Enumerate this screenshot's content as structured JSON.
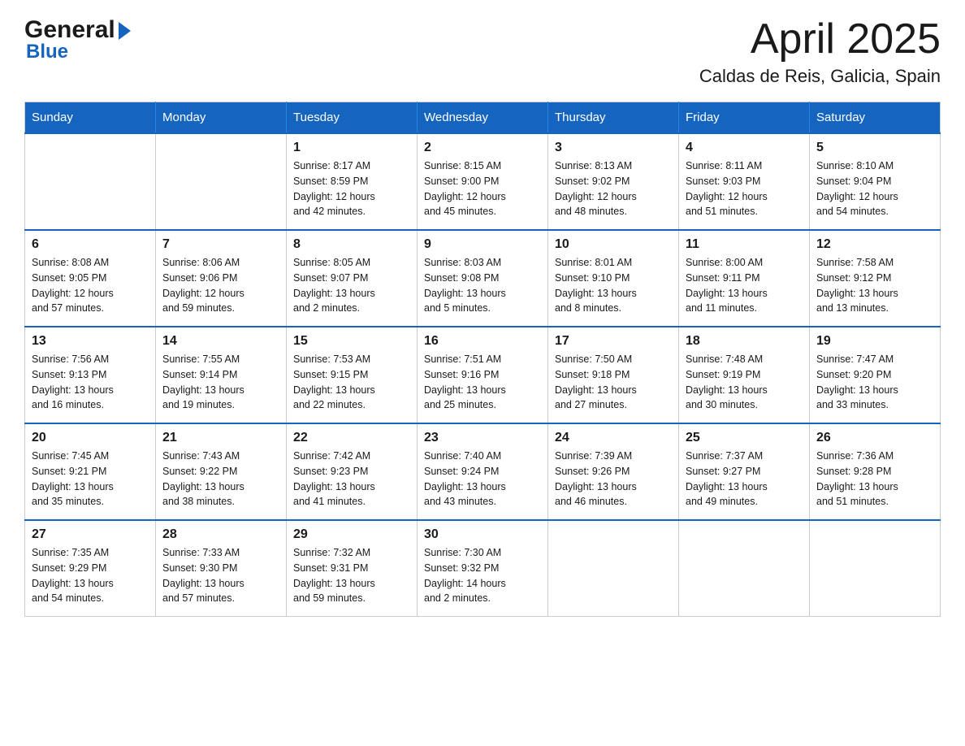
{
  "logo": {
    "general": "General",
    "blue": "Blue"
  },
  "title": "April 2025",
  "subtitle": "Caldas de Reis, Galicia, Spain",
  "days_of_week": [
    "Sunday",
    "Monday",
    "Tuesday",
    "Wednesday",
    "Thursday",
    "Friday",
    "Saturday"
  ],
  "weeks": [
    [
      {
        "day": "",
        "info": ""
      },
      {
        "day": "",
        "info": ""
      },
      {
        "day": "1",
        "info": "Sunrise: 8:17 AM\nSunset: 8:59 PM\nDaylight: 12 hours\nand 42 minutes."
      },
      {
        "day": "2",
        "info": "Sunrise: 8:15 AM\nSunset: 9:00 PM\nDaylight: 12 hours\nand 45 minutes."
      },
      {
        "day": "3",
        "info": "Sunrise: 8:13 AM\nSunset: 9:02 PM\nDaylight: 12 hours\nand 48 minutes."
      },
      {
        "day": "4",
        "info": "Sunrise: 8:11 AM\nSunset: 9:03 PM\nDaylight: 12 hours\nand 51 minutes."
      },
      {
        "day": "5",
        "info": "Sunrise: 8:10 AM\nSunset: 9:04 PM\nDaylight: 12 hours\nand 54 minutes."
      }
    ],
    [
      {
        "day": "6",
        "info": "Sunrise: 8:08 AM\nSunset: 9:05 PM\nDaylight: 12 hours\nand 57 minutes."
      },
      {
        "day": "7",
        "info": "Sunrise: 8:06 AM\nSunset: 9:06 PM\nDaylight: 12 hours\nand 59 minutes."
      },
      {
        "day": "8",
        "info": "Sunrise: 8:05 AM\nSunset: 9:07 PM\nDaylight: 13 hours\nand 2 minutes."
      },
      {
        "day": "9",
        "info": "Sunrise: 8:03 AM\nSunset: 9:08 PM\nDaylight: 13 hours\nand 5 minutes."
      },
      {
        "day": "10",
        "info": "Sunrise: 8:01 AM\nSunset: 9:10 PM\nDaylight: 13 hours\nand 8 minutes."
      },
      {
        "day": "11",
        "info": "Sunrise: 8:00 AM\nSunset: 9:11 PM\nDaylight: 13 hours\nand 11 minutes."
      },
      {
        "day": "12",
        "info": "Sunrise: 7:58 AM\nSunset: 9:12 PM\nDaylight: 13 hours\nand 13 minutes."
      }
    ],
    [
      {
        "day": "13",
        "info": "Sunrise: 7:56 AM\nSunset: 9:13 PM\nDaylight: 13 hours\nand 16 minutes."
      },
      {
        "day": "14",
        "info": "Sunrise: 7:55 AM\nSunset: 9:14 PM\nDaylight: 13 hours\nand 19 minutes."
      },
      {
        "day": "15",
        "info": "Sunrise: 7:53 AM\nSunset: 9:15 PM\nDaylight: 13 hours\nand 22 minutes."
      },
      {
        "day": "16",
        "info": "Sunrise: 7:51 AM\nSunset: 9:16 PM\nDaylight: 13 hours\nand 25 minutes."
      },
      {
        "day": "17",
        "info": "Sunrise: 7:50 AM\nSunset: 9:18 PM\nDaylight: 13 hours\nand 27 minutes."
      },
      {
        "day": "18",
        "info": "Sunrise: 7:48 AM\nSunset: 9:19 PM\nDaylight: 13 hours\nand 30 minutes."
      },
      {
        "day": "19",
        "info": "Sunrise: 7:47 AM\nSunset: 9:20 PM\nDaylight: 13 hours\nand 33 minutes."
      }
    ],
    [
      {
        "day": "20",
        "info": "Sunrise: 7:45 AM\nSunset: 9:21 PM\nDaylight: 13 hours\nand 35 minutes."
      },
      {
        "day": "21",
        "info": "Sunrise: 7:43 AM\nSunset: 9:22 PM\nDaylight: 13 hours\nand 38 minutes."
      },
      {
        "day": "22",
        "info": "Sunrise: 7:42 AM\nSunset: 9:23 PM\nDaylight: 13 hours\nand 41 minutes."
      },
      {
        "day": "23",
        "info": "Sunrise: 7:40 AM\nSunset: 9:24 PM\nDaylight: 13 hours\nand 43 minutes."
      },
      {
        "day": "24",
        "info": "Sunrise: 7:39 AM\nSunset: 9:26 PM\nDaylight: 13 hours\nand 46 minutes."
      },
      {
        "day": "25",
        "info": "Sunrise: 7:37 AM\nSunset: 9:27 PM\nDaylight: 13 hours\nand 49 minutes."
      },
      {
        "day": "26",
        "info": "Sunrise: 7:36 AM\nSunset: 9:28 PM\nDaylight: 13 hours\nand 51 minutes."
      }
    ],
    [
      {
        "day": "27",
        "info": "Sunrise: 7:35 AM\nSunset: 9:29 PM\nDaylight: 13 hours\nand 54 minutes."
      },
      {
        "day": "28",
        "info": "Sunrise: 7:33 AM\nSunset: 9:30 PM\nDaylight: 13 hours\nand 57 minutes."
      },
      {
        "day": "29",
        "info": "Sunrise: 7:32 AM\nSunset: 9:31 PM\nDaylight: 13 hours\nand 59 minutes."
      },
      {
        "day": "30",
        "info": "Sunrise: 7:30 AM\nSunset: 9:32 PM\nDaylight: 14 hours\nand 2 minutes."
      },
      {
        "day": "",
        "info": ""
      },
      {
        "day": "",
        "info": ""
      },
      {
        "day": "",
        "info": ""
      }
    ]
  ]
}
